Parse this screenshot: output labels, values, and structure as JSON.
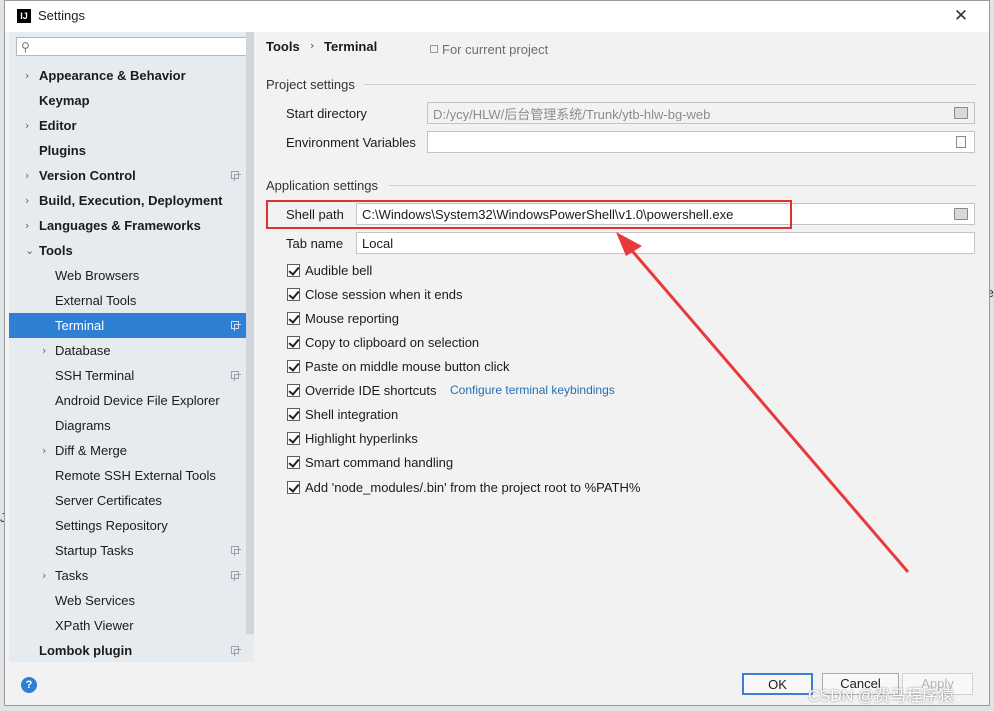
{
  "window": {
    "title": "Settings",
    "app_icon_text": "IJ",
    "close_symbol": "✕"
  },
  "sidebar": {
    "search_placeholder": "",
    "search_icon": "search-icon",
    "items": [
      {
        "label": "Appearance & Behavior",
        "bold": true,
        "expandable": true
      },
      {
        "label": "Keymap",
        "bold": true
      },
      {
        "label": "Editor",
        "bold": true,
        "expandable": true
      },
      {
        "label": "Plugins",
        "bold": true
      },
      {
        "label": "Version Control",
        "bold": true,
        "expandable": true,
        "project_scope": true
      },
      {
        "label": "Build, Execution, Deployment",
        "bold": true,
        "expandable": true
      },
      {
        "label": "Languages & Frameworks",
        "bold": true,
        "expandable": true
      },
      {
        "label": "Tools",
        "bold": true,
        "expanded": true
      },
      {
        "label": "Web Browsers"
      },
      {
        "label": "External Tools"
      },
      {
        "label": "Terminal",
        "selected": true,
        "project_scope": true
      },
      {
        "label": "Database",
        "expandable": true
      },
      {
        "label": "SSH Terminal",
        "project_scope": true
      },
      {
        "label": "Android Device File Explorer"
      },
      {
        "label": "Diagrams"
      },
      {
        "label": "Diff & Merge",
        "expandable": true
      },
      {
        "label": "Remote SSH External Tools"
      },
      {
        "label": "Server Certificates"
      },
      {
        "label": "Settings Repository"
      },
      {
        "label": "Startup Tasks",
        "project_scope": true
      },
      {
        "label": "Tasks",
        "expandable": true,
        "project_scope": true
      },
      {
        "label": "Web Services"
      },
      {
        "label": "XPath Viewer"
      },
      {
        "label": "Lombok plugin",
        "bold": true,
        "project_scope": true
      }
    ]
  },
  "breadcrumb": {
    "parent": "Tools",
    "separator": "›",
    "current": "Terminal",
    "scope_note": "For current project"
  },
  "project_settings": {
    "title": "Project settings",
    "start_directory_label": "Start directory",
    "start_directory_value": "D:/ycy/HLW/后台管理系统/Trunk/ytb-hlw-bg-web",
    "env_vars_label": "Environment Variables",
    "env_vars_value": ""
  },
  "app_settings": {
    "title": "Application settings",
    "shell_path_label": "Shell path",
    "shell_path_value": "C:\\Windows\\System32\\WindowsPowerShell\\v1.0\\powershell.exe",
    "tab_name_label": "Tab name",
    "tab_name_value": "Local",
    "checkboxes": [
      {
        "label": "Audible bell",
        "checked": true
      },
      {
        "label": "Close session when it ends",
        "checked": true
      },
      {
        "label": "Mouse reporting",
        "checked": true
      },
      {
        "label": "Copy to clipboard on selection",
        "checked": true
      },
      {
        "label": "Paste on middle mouse button click",
        "checked": true
      },
      {
        "label": "Override IDE shortcuts",
        "checked": true
      },
      {
        "label": "Shell integration",
        "checked": true
      },
      {
        "label": "Highlight hyperlinks",
        "checked": true
      },
      {
        "label": "Smart command handling",
        "checked": true
      },
      {
        "label": "Add 'node_modules/.bin' from the project root to %PATH%",
        "checked": true
      }
    ],
    "keybindings_link": "Configure terminal keybindings"
  },
  "annotation": {
    "highlight_color": "#e03030",
    "arrow_color": "#e83a3a"
  },
  "footer": {
    "help_symbol": "?",
    "ok_label": "OK",
    "cancel_label": "Cancel",
    "apply_label": "Apply"
  },
  "watermark": "CSDN @费马程序猿",
  "colors": {
    "selection": "#2f7fd4",
    "link": "#2470b3",
    "sidebar_bg": "#e6ebf0",
    "content_bg": "#f2f2f2"
  }
}
